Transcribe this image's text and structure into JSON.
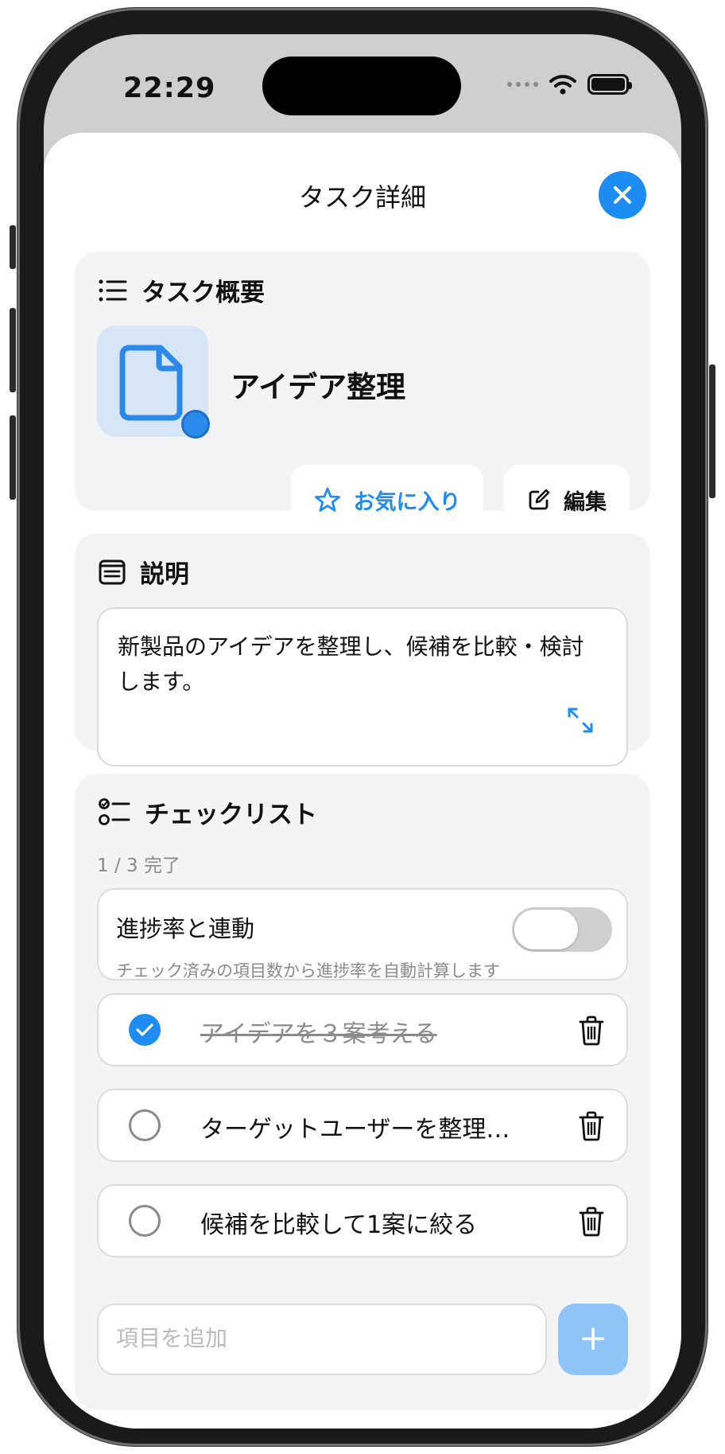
{
  "status_bar": {
    "time": "22:29"
  },
  "sheet": {
    "title": "タスク詳細"
  },
  "overview": {
    "header": "タスク概要",
    "task_name": "アイデア整理",
    "favorite_label": "お気に入り",
    "edit_label": "編集"
  },
  "description": {
    "header": "説明",
    "text": "新製品のアイデアを整理し、候補を比較・検討します。"
  },
  "checklist": {
    "header": "チェックリスト",
    "progress": "1 / 3 完了",
    "sync_title": "進捗率と連動",
    "sync_subtitle": "チェック済みの項目数から進捗率を自動計算します",
    "sync_enabled": false,
    "items": [
      {
        "text": "アイデアを３案考える",
        "checked": true
      },
      {
        "text": "ターゲットユーザーを整理…",
        "checked": false
      },
      {
        "text": "候補を比較して1案に絞る",
        "checked": false
      }
    ],
    "add_placeholder": "項目を追加",
    "add_button": "+"
  },
  "colors": {
    "accent": "#1d8cf3",
    "card_bg": "#f4f4f4"
  }
}
